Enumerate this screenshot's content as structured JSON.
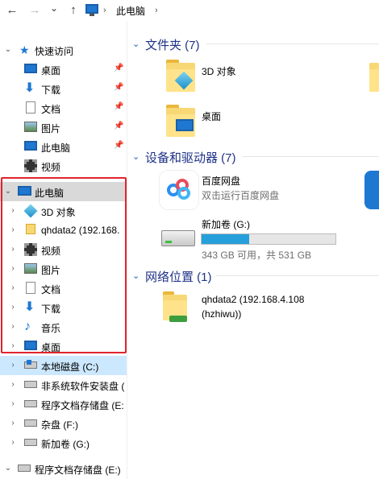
{
  "nav": {
    "back_glyph": "←",
    "forward_glyph": "→",
    "dropdown_glyph": "⌄",
    "up_glyph": "↑",
    "breadcrumb_location": "此电脑",
    "separator": "›"
  },
  "tree": {
    "quick_access": {
      "label": "快速访问",
      "items": [
        {
          "label": "桌面",
          "icon": "desktop-icon",
          "pinned": true
        },
        {
          "label": "下载",
          "icon": "download-icon",
          "pinned": true
        },
        {
          "label": "文档",
          "icon": "document-icon",
          "pinned": true
        },
        {
          "label": "图片",
          "icon": "picture-icon",
          "pinned": true
        },
        {
          "label": "此电脑",
          "icon": "computer-icon",
          "pinned": true
        },
        {
          "label": "视频",
          "icon": "video-icon",
          "pinned": false
        }
      ]
    },
    "this_pc": {
      "label": "此电脑",
      "children": [
        {
          "label": "3D 对象",
          "icon": "3d-objects-icon"
        },
        {
          "label": "qhdata2 (192.168.",
          "icon": "network-drive-icon"
        },
        {
          "label": "视频",
          "icon": "video-icon"
        },
        {
          "label": "图片",
          "icon": "picture-icon"
        },
        {
          "label": "文档",
          "icon": "document-icon"
        },
        {
          "label": "下载",
          "icon": "download-icon"
        },
        {
          "label": "音乐",
          "icon": "music-icon"
        },
        {
          "label": "桌面",
          "icon": "desktop-icon"
        }
      ],
      "drives": [
        {
          "label": "本地磁盘 (C:)",
          "icon": "windows-drive-icon",
          "highlighted": true
        },
        {
          "label": "非系统软件安装盘 (",
          "icon": "drive-icon"
        },
        {
          "label": "程序文档存储盘 (E:",
          "icon": "drive-icon"
        },
        {
          "label": "杂盘 (F:)",
          "icon": "drive-icon"
        },
        {
          "label": "新加卷 (G:)",
          "icon": "drive-icon"
        }
      ]
    },
    "extra_drive": {
      "label": "程序文档存储盘 (E:)",
      "icon": "drive-icon"
    }
  },
  "content": {
    "folders_group": {
      "title": "文件夹 (7)",
      "items": [
        {
          "label": "3D 对象",
          "icon": "3d-objects-folder-icon"
        },
        {
          "label": "桌面",
          "icon": "desktop-folder-icon"
        }
      ]
    },
    "devices_group": {
      "title": "设备和驱动器 (7)",
      "items": [
        {
          "label": "百度网盘",
          "sublabel": "双击运行百度网盘",
          "icon": "baidu-netdisk-icon"
        },
        {
          "label": "新加卷 (G:)",
          "sublabel": "343 GB 可用，共 531 GB",
          "icon": "drive-icon",
          "used_fraction": 0.354
        }
      ]
    },
    "network_group": {
      "title": "网络位置 (1)",
      "items": [
        {
          "label": "qhdata2 (192.168.4.108",
          "label2": "(hzhiwu))",
          "icon": "network-drive-folder-icon"
        }
      ]
    }
  },
  "colors": {
    "selection_gray": "#d9d9d9",
    "highlight_blue": "#cce8ff",
    "group_title": "#1e3287",
    "annotation_red": "#e0242c",
    "progress_fill": "#26a0da"
  }
}
